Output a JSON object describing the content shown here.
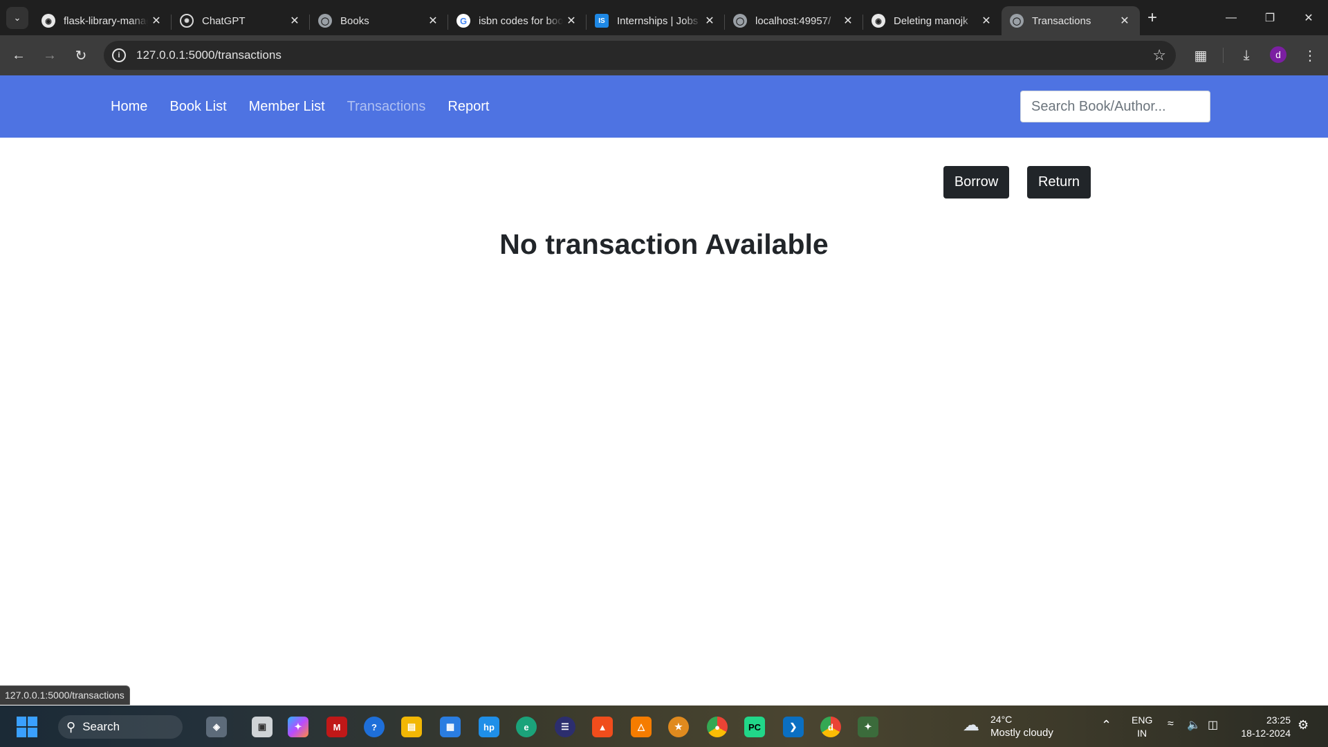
{
  "browser": {
    "tabs": [
      {
        "title": "flask-library-management",
        "favicon": "github-icon"
      },
      {
        "title": "ChatGPT",
        "favicon": "chatgpt-icon"
      },
      {
        "title": "Books",
        "favicon": "globe-icon"
      },
      {
        "title": "isbn codes for books",
        "favicon": "google-icon"
      },
      {
        "title": "Internships | Jobs",
        "favicon": "internshala-icon"
      },
      {
        "title": "localhost:49957/",
        "favicon": "globe-icon"
      },
      {
        "title": "Deleting manojk",
        "favicon": "github-icon"
      },
      {
        "title": "Transactions",
        "favicon": "globe-icon"
      }
    ],
    "active_tab_index": 7,
    "url": "127.0.0.1:5000/transactions",
    "profile_initial": "d",
    "status_url": "127.0.0.1:5000/transactions"
  },
  "navbar": {
    "links": [
      "Home",
      "Book List",
      "Member List",
      "Transactions",
      "Report"
    ],
    "active_link": "Transactions",
    "search_placeholder": "Search Book/Author...",
    "color": "#4e73e2"
  },
  "main": {
    "borrow_label": "Borrow",
    "return_label": "Return",
    "heading": "No transaction Available"
  },
  "taskbar": {
    "search_label": "Search",
    "weather_temp": "24°C",
    "weather_desc": "Mostly cloudy",
    "lang_line1": "ENG",
    "lang_line2": "IN",
    "time": "23:25",
    "date": "18-12-2024"
  }
}
